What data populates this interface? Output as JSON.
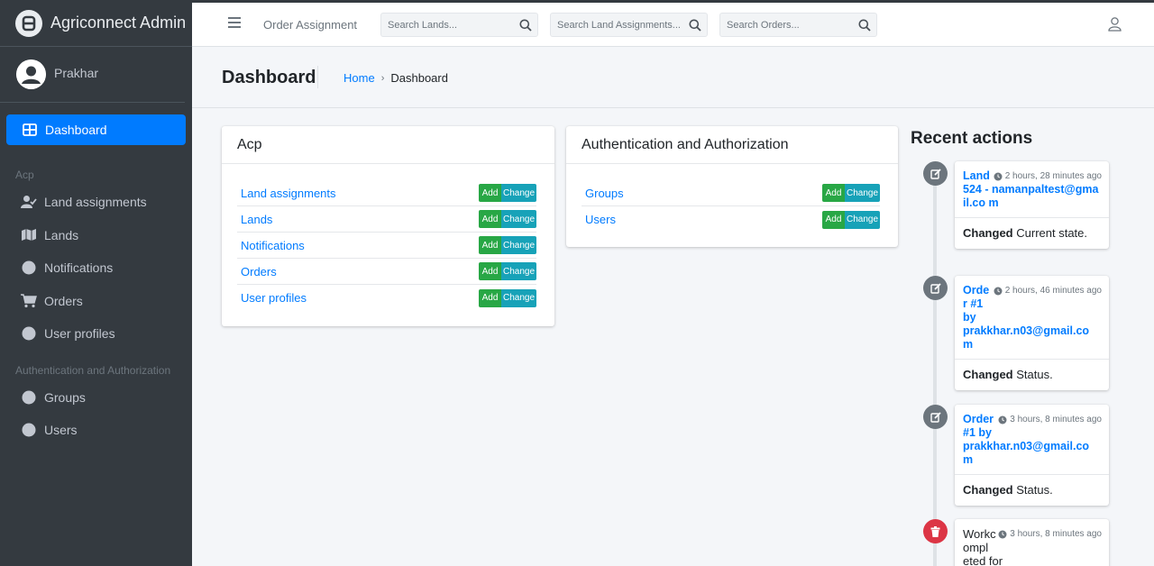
{
  "brand": {
    "title": "Agriconnect Admin"
  },
  "user": {
    "name": "Prakhar"
  },
  "sidebar": {
    "dashboard_label": "Dashboard",
    "sections": [
      {
        "header": "Acp",
        "items": [
          {
            "label": "Land assignments",
            "icon": "user-check-icon"
          },
          {
            "label": "Lands",
            "icon": "map-icon"
          },
          {
            "label": "Notifications",
            "icon": "circle-icon"
          },
          {
            "label": "Orders",
            "icon": "cart-icon"
          },
          {
            "label": "User profiles",
            "icon": "circle-icon"
          }
        ]
      },
      {
        "header": "Authentication and Authorization",
        "items": [
          {
            "label": "Groups",
            "icon": "circle-icon"
          },
          {
            "label": "Users",
            "icon": "circle-icon"
          }
        ]
      }
    ]
  },
  "topbar": {
    "link": "Order Assignment",
    "search_lands": "Search Lands...",
    "search_land_assignments": "Search Land Assignments...",
    "search_orders": "Search Orders..."
  },
  "header": {
    "title": "Dashboard",
    "breadcrumb_home": "Home",
    "breadcrumb_sep": "›",
    "breadcrumb_current": "Dashboard"
  },
  "buttons": {
    "add": "Add",
    "change": "Change"
  },
  "apps": [
    {
      "title": "Acp",
      "models": [
        "Land assignments",
        "Lands",
        "Notifications",
        "Orders",
        "User profiles"
      ]
    },
    {
      "title": "Authentication and Authorization",
      "models": [
        "Groups",
        "Users"
      ]
    }
  ],
  "recent": {
    "title": "Recent actions",
    "items": [
      {
        "type": "edit",
        "object": "Land 524 - namanpaltest@gmail.com",
        "time": "2 hours, 28 minutes ago",
        "verb": "Changed",
        "detail": "Current state."
      },
      {
        "type": "edit",
        "object": "Order #1 by prakkhar.n03@gmail.com",
        "time": "2 hours, 46 minutes ago",
        "verb": "Changed",
        "detail": "Status."
      },
      {
        "type": "edit",
        "object": "Order #1 by prakkhar.n03@gmail.com",
        "time": "3 hours, 8 minutes ago",
        "verb": "Changed",
        "detail": "Status."
      },
      {
        "type": "delete",
        "object": "Workcompleted for",
        "time": "3 hours, 8 minutes ago",
        "verb": "",
        "detail": ""
      }
    ]
  },
  "colors": {
    "sidebar": "#343a40",
    "primary": "#007bff",
    "add": "#28a745",
    "change": "#17a2b8",
    "delete": "#dc3545"
  }
}
